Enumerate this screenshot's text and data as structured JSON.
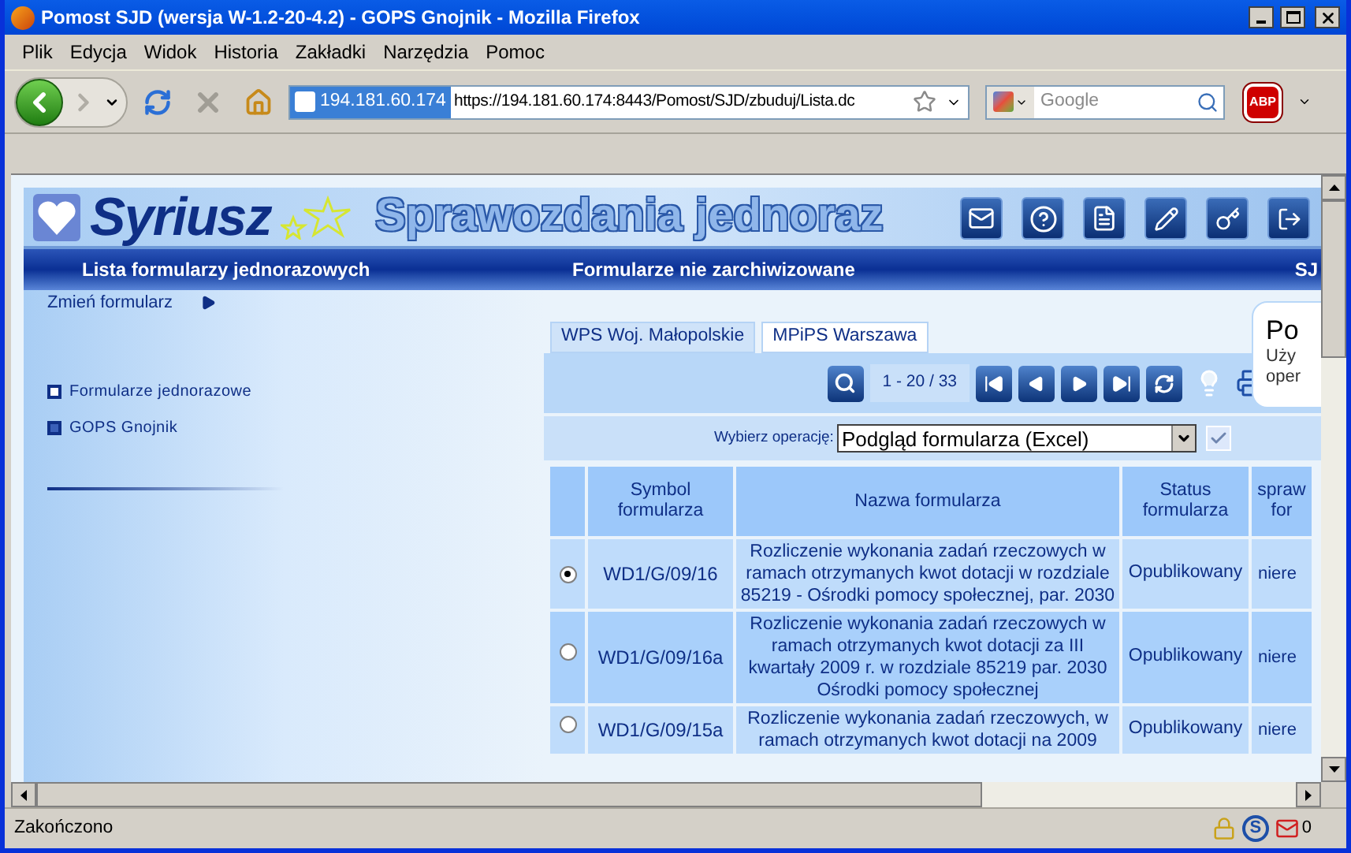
{
  "window": {
    "title": "Pomost SJD (wersja W-1.2-20-4.2) - GOPS Gnojnik - Mozilla Firefox"
  },
  "menu": [
    "Plik",
    "Edycja",
    "Widok",
    "Historia",
    "Zakładki",
    "Narzędzia",
    "Pomoc"
  ],
  "address_bar": {
    "site": "194.181.60.174",
    "url": "https://194.181.60.174:8443/Pomost/SJD/zbuduj/Lista.dc"
  },
  "search_bar": {
    "placeholder": "Google"
  },
  "adblock": {
    "label": "ABP"
  },
  "banner": {
    "logo": "Syriusz",
    "title": "Sprawozdania jednoraz"
  },
  "header_bar": {
    "left": "Lista formularzy jednorazowych",
    "center": "Formularze nie zarchiwizowane",
    "right": "SJ"
  },
  "sidebar": {
    "change_link": "Zmień formularz",
    "items": [
      {
        "label": "Formularze jednorazowe",
        "selected": false
      },
      {
        "label": "GOPS Gnojnik",
        "selected": true
      }
    ]
  },
  "tabs": [
    {
      "label": "WPS Woj. Małopolskie",
      "selected": false
    },
    {
      "label": "MPiPS Warszawa",
      "selected": true
    }
  ],
  "pager": {
    "range": "1 - 20 / 33"
  },
  "operation": {
    "label": "Wybierz operację:",
    "value": "Podgląd formularza (Excel)"
  },
  "tooltip": {
    "title": "Po",
    "lines": [
      "Uży",
      "oper"
    ]
  },
  "table": {
    "columns": [
      "Symbol formularza",
      "Nazwa formularza",
      "Status formularza",
      "spraw for"
    ],
    "rows": [
      {
        "selected": true,
        "symbol": "WD1/G/09/16",
        "name": "Rozliczenie wykonania zadań rzeczowych w ramach otrzymanych kwot dotacji w rozdziale 85219 - Ośrodki pomocy społecznej, par. 2030",
        "status": "Opublikowany",
        "column_5": "niere"
      },
      {
        "selected": false,
        "symbol": "WD1/G/09/16a",
        "name": "Rozliczenie wykonania zadań rzeczowych w ramach otrzymanych kwot dotacji za III kwartały 2009 r. w rozdziale 85219 par. 2030 Ośrodki pomocy społecznej",
        "status": "Opublikowany",
        "column_5": "niere"
      },
      {
        "selected": false,
        "symbol": "WD1/G/09/15a",
        "name": "Rozliczenie wykonania zadań rzeczowych, w ramach otrzymanych kwot dotacji na 2009",
        "status": "Opublikowany",
        "column_5": "niere"
      }
    ]
  },
  "status_bar": {
    "text": "Zakończono",
    "s_icon": "S",
    "mail_count": "0"
  }
}
